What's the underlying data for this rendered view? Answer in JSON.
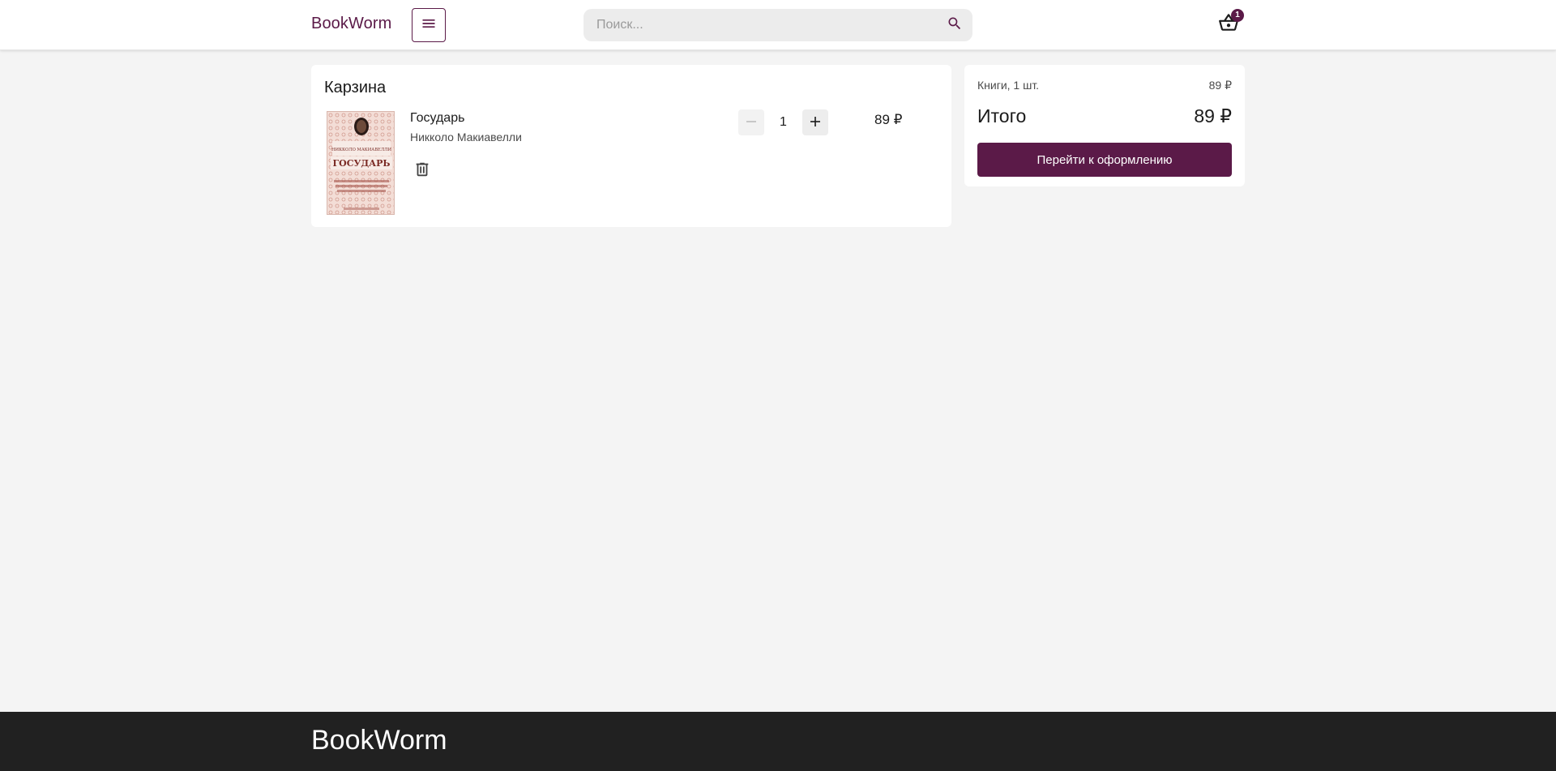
{
  "header": {
    "logo": "BookWorm",
    "search_placeholder": "Поиск...",
    "cart_count": "1",
    "accent": "#5b1a48"
  },
  "icons": {
    "menu": "menu-icon",
    "search": "search-icon",
    "cart": "basket-icon",
    "delete": "trash-icon",
    "minus": "minus-icon",
    "plus": "plus-icon"
  },
  "cart": {
    "title": "Карзина",
    "items": [
      {
        "name": "Государь",
        "author": "Никколо Макиавелли",
        "quantity": "1",
        "price": "89 ₽",
        "cover": {
          "author": "НИККОЛО МАКИАВЕЛЛИ",
          "title": "ГОСУДАРЬ"
        }
      }
    ]
  },
  "summary": {
    "line_label": "Книги, 1 шт.",
    "line_value": "89 ₽",
    "total_label": "Итого",
    "total_value": "89 ₽",
    "checkout_label": "Перейти к оформлению"
  },
  "footer": {
    "logo": "BookWorm"
  }
}
